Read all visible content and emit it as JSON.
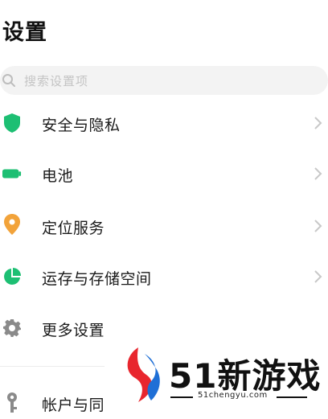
{
  "header": {
    "title": "设置"
  },
  "search": {
    "placeholder": "搜索设置项",
    "icon": "search-icon"
  },
  "items": [
    {
      "label": "安全与隐私",
      "icon": "shield-icon",
      "color": "#1dbf73"
    },
    {
      "label": "电池",
      "icon": "battery-icon",
      "color": "#1dbf73"
    },
    {
      "label": "定位服务",
      "icon": "location-pin-icon",
      "color": "#f2a33a"
    },
    {
      "label": "运存与存储空间",
      "icon": "storage-pie-icon",
      "color": "#1dbf73"
    },
    {
      "label": "更多设置",
      "icon": "gear-icon",
      "color": "#8a8a8a"
    },
    {
      "label": "帐户与同",
      "icon": "key-icon",
      "color": "#8a8a8a"
    }
  ],
  "watermark": {
    "title": "51新游戏",
    "url": "51chengyu.com",
    "logo_colors": [
      "#e8262e",
      "#1f6fd6"
    ]
  }
}
